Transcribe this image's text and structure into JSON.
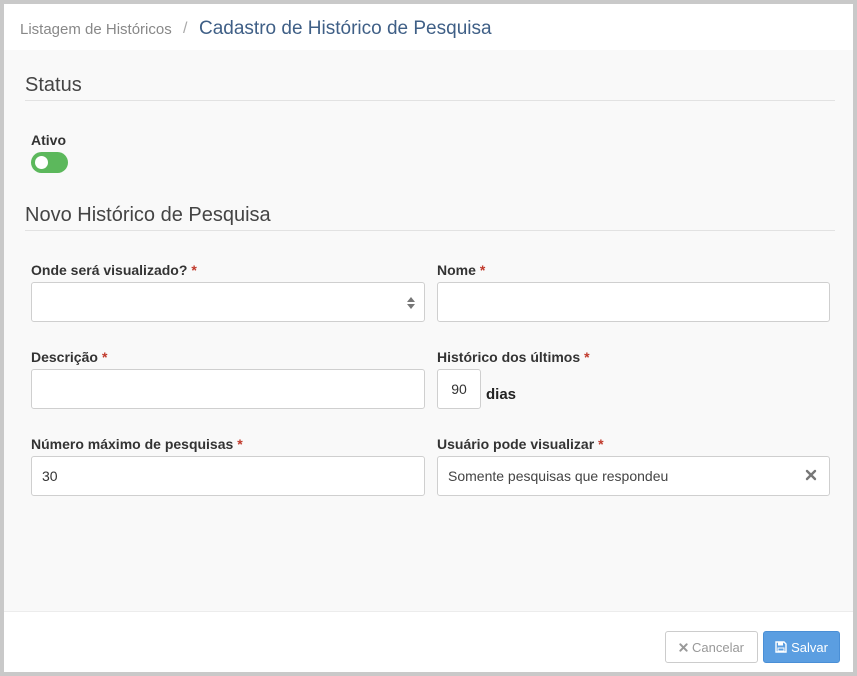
{
  "breadcrumb": {
    "previous": "Listagem de Históricos",
    "separator": "/",
    "current": "Cadastro de Histórico de Pesquisa"
  },
  "status_section": {
    "title": "Status",
    "active_label": "Ativo",
    "active_on": true
  },
  "form_section": {
    "title": "Novo Histórico de Pesquisa"
  },
  "fields": {
    "visualizado": {
      "label": "Onde será visualizado?",
      "required": "*",
      "value": ""
    },
    "nome": {
      "label": "Nome",
      "required": "*",
      "value": ""
    },
    "descricao": {
      "label": "Descrição",
      "required": "*",
      "value": ""
    },
    "historico": {
      "label": "Histórico dos últimos",
      "required": "*",
      "value": "90",
      "unit": "dias"
    },
    "max_pesquisas": {
      "label": "Número máximo de pesquisas",
      "required": "*",
      "value": "30"
    },
    "usuario_visualizar": {
      "label": "Usuário pode visualizar",
      "required": "*",
      "value": "Somente pesquisas que respondeu"
    }
  },
  "footer": {
    "cancel_label": "Cancelar",
    "save_label": "Salvar"
  },
  "colors": {
    "accent": "#3f5f86",
    "toggle_on": "#5cb85c",
    "save_button": "#5b9ee1",
    "required": "#c0392b"
  },
  "icons": {
    "cancel": "times-icon",
    "save": "floppy-disk-icon",
    "clear": "times-icon",
    "select": "sort-arrows-icon"
  }
}
